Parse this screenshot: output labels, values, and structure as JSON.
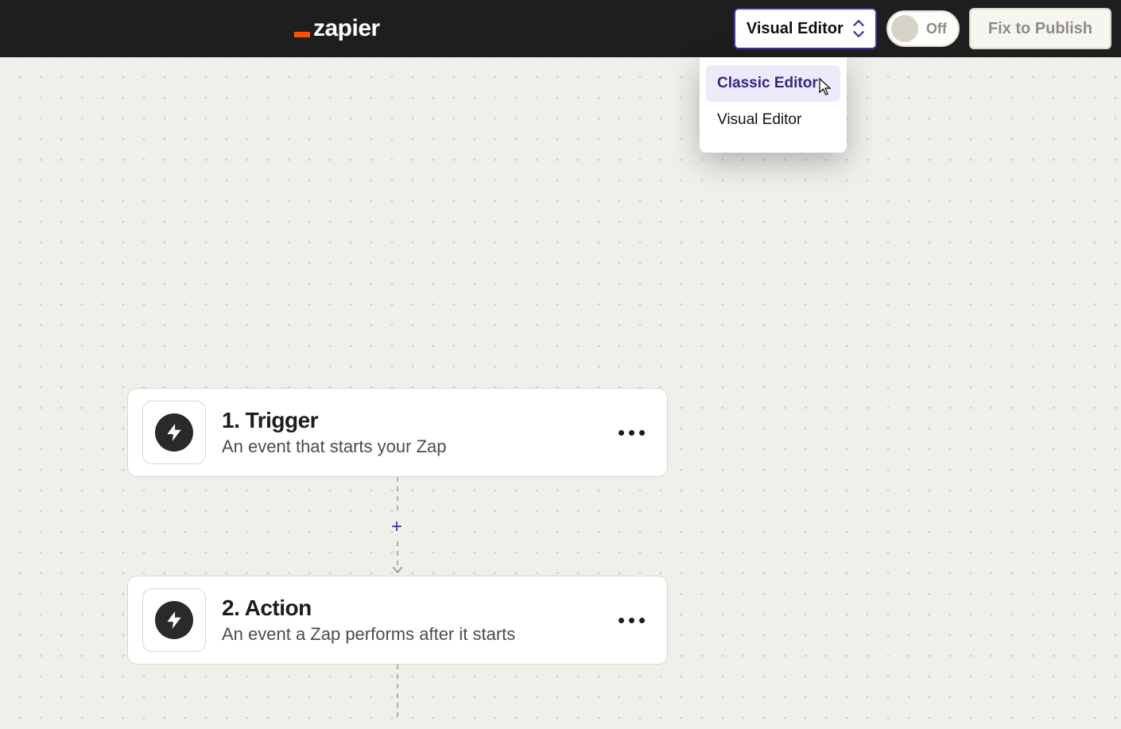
{
  "header": {
    "brand": "zapier",
    "editor_select_label": "Visual Editor",
    "toggle_label": "Off",
    "publish_label": "Fix to Publish"
  },
  "dropdown": {
    "items": [
      {
        "label": "Classic Editor",
        "active": true
      },
      {
        "label": "Visual Editor",
        "active": false
      }
    ]
  },
  "steps": [
    {
      "title": "1. Trigger",
      "desc": "An event that starts your Zap"
    },
    {
      "title": "2. Action",
      "desc": "An event a Zap performs after it starts"
    }
  ],
  "add_step_glyph": "+"
}
